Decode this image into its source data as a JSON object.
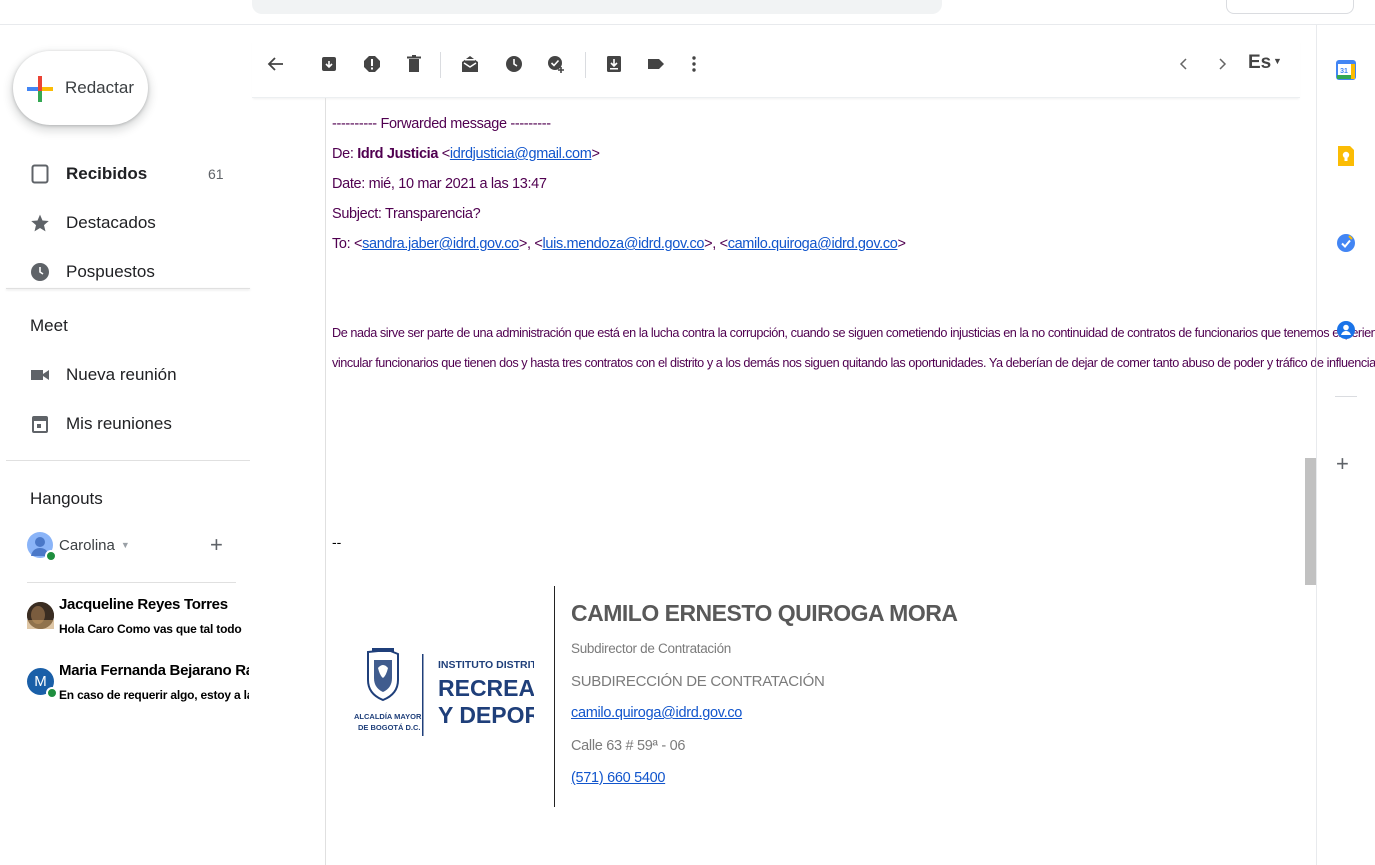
{
  "compose": {
    "label": "Redactar"
  },
  "nav": {
    "inbox": {
      "label": "Recibidos",
      "count": "61"
    },
    "starred": {
      "label": "Destacados"
    },
    "snoozed": {
      "label": "Pospuestos"
    }
  },
  "meet": {
    "title": "Meet",
    "new_meeting": "Nueva reunión",
    "my_meetings": "Mis reuniones"
  },
  "hangouts": {
    "title": "Hangouts",
    "user": "Carolina",
    "chats": [
      {
        "name": "Jacqueline Reyes Torres",
        "snippet": "Hola Caro Como vas que tal todo"
      },
      {
        "name": "Maria Fernanda Bejarano Ran",
        "snippet": "En caso de requerir algo, estoy a la",
        "initial": "M"
      }
    ]
  },
  "toolbar": {
    "input_tools": "Es"
  },
  "message": {
    "forward_header": "---------- Forwarded message ---------",
    "from_label": "De: ",
    "from_name": "Idrd Justicia",
    "from_email": "idrdjusticia@gmail.com",
    "date": "Date: mié, 10 mar 2021 a las 13:47",
    "subject": "Subject: Transparencia?",
    "to_label": "To: ",
    "to": [
      "sandra.jaber@idrd.gov.co",
      "luis.mendoza@idrd.gov.co",
      "camilo.quiroga@idrd.gov.co"
    ],
    "body_line1": "De nada sirve ser parte de una administración que está en la lucha contra la corrupción, cuando se siguen cometiendo injusticias en la no continuidad de contratos de funcionarios que tenemos experiencia para",
    "body_line2": "vincular funcionarios que tienen dos y hasta tres contratos con el distrito y a los demás nos siguen quitando las oportunidades.  Ya deberían de dejar de comer tanto abuso de poder y tráfico de influencias.",
    "sig_dash": "--"
  },
  "signature": {
    "name": "CAMILO ERNESTO QUIROGA MORA",
    "title": "Subdirector de Contratación",
    "department": "SUBDIRECCIÓN DE CONTRATACIÓN",
    "email": "camilo.quiroga@idrd.gov.co",
    "address": "Calle 63 # 59ª - 06",
    "phone": "(571) 660 5400",
    "logo_left_text1": "ALCALDÍA MAYOR",
    "logo_left_text2": "DE BOGOTÁ D.C.",
    "logo_right_text1": "INSTITUTO DISTRITAL DE",
    "logo_right_text2": "RECREACIÓN",
    "logo_right_text3": "Y DEPORTE"
  },
  "side_panel": {
    "calendar_day": "31"
  },
  "colors": {
    "quoted_text": "#500050",
    "link": "#1155cc",
    "signature_gray": "#595959",
    "logo_blue": "#1f3f7a"
  }
}
